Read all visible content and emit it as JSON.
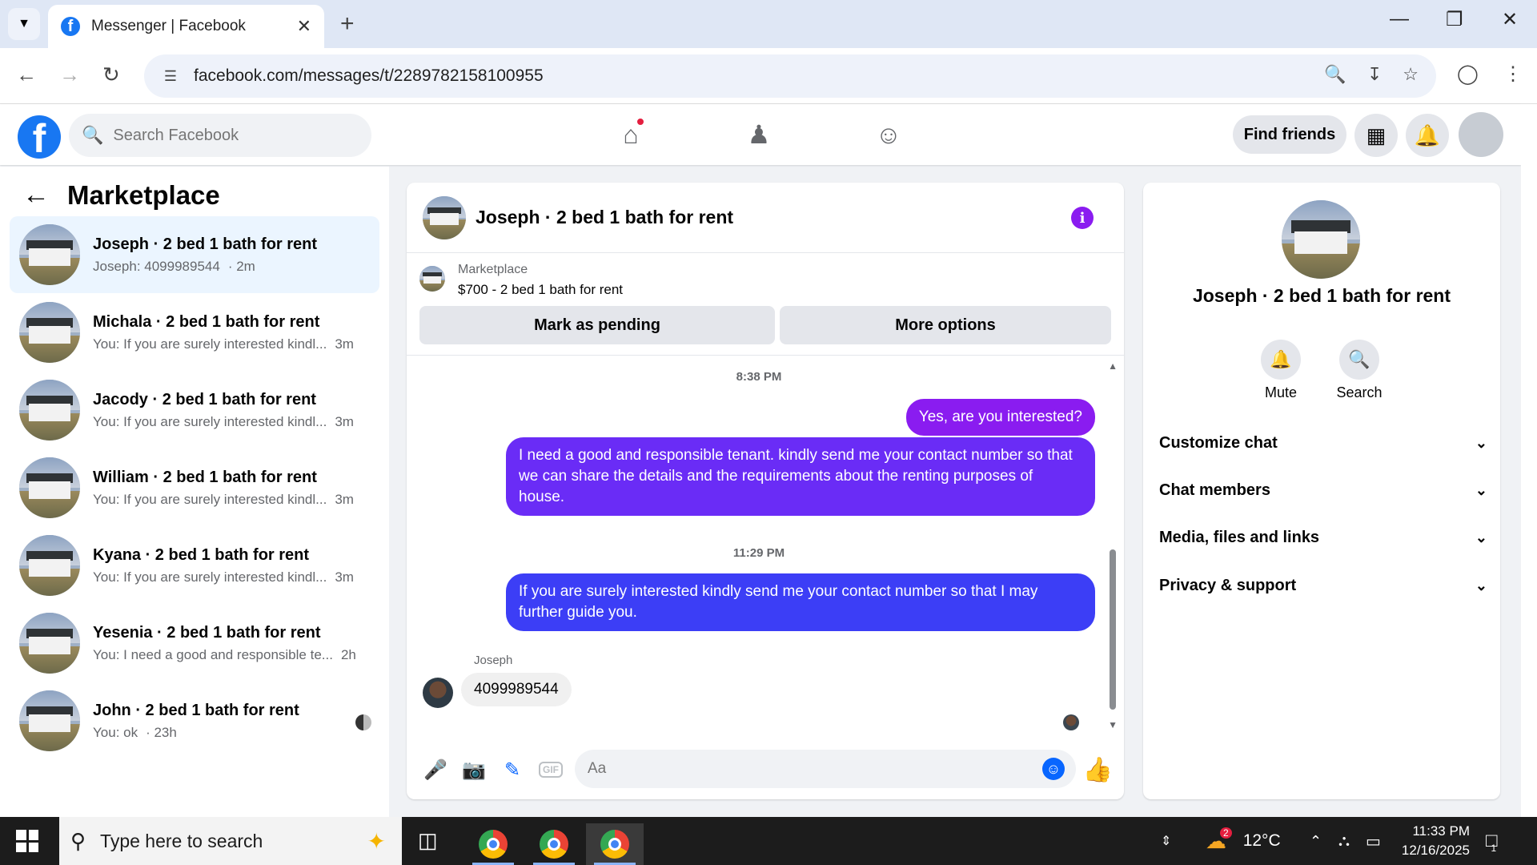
{
  "browser": {
    "tab_title": "Messenger | Facebook",
    "url": "facebook.com/messages/t/2289782158100955"
  },
  "fb": {
    "search_placeholder": "Search Facebook",
    "find_friends": "Find friends"
  },
  "left": {
    "title": "Marketplace",
    "conversations": [
      {
        "name": "Joseph · 2 bed 1 bath for rent",
        "preview": "Joseph: 4099989544",
        "time": "· 2m"
      },
      {
        "name": "Michala · 2 bed 1 bath for rent",
        "preview": "You: If you are surely interested kindl...",
        "time": "3m"
      },
      {
        "name": "Jacody · 2 bed 1 bath for rent",
        "preview": "You: If you are surely interested kindl...",
        "time": "3m"
      },
      {
        "name": "William · 2 bed 1 bath for rent",
        "preview": "You: If you are surely interested kindl...",
        "time": "3m"
      },
      {
        "name": "Kyana · 2 bed 1 bath for rent",
        "preview": "You: If you are surely interested kindl...",
        "time": "3m"
      },
      {
        "name": "Yesenia · 2 bed 1 bath for rent",
        "preview": "You: I need a good and responsible te...",
        "time": "2h"
      },
      {
        "name": "John · 2 bed 1 bath for rent",
        "preview": "You: ok",
        "time": "· 23h"
      }
    ]
  },
  "chat": {
    "title": "Joseph · 2 bed 1 bath for rent",
    "marketplace_label": "Marketplace",
    "listing": "$700 - 2 bed 1 bath for rent",
    "mark_pending": "Mark as pending",
    "more_options": "More options",
    "ts1": "8:38 PM",
    "msg1": "Yes, are you interested?",
    "msg2": "I need a good and responsible tenant.  kindly send me your contact number so that we can share the details and the requirements about the renting purposes of house.",
    "ts2": "11:29 PM",
    "msg3": "If you are surely interested kindly send me your contact number so that I may further guide you.",
    "sender": "Joseph",
    "reply": "4099989544",
    "composer_placeholder": "Aa",
    "gif": "GIF"
  },
  "details": {
    "title": "Joseph · 2 bed 1 bath for rent",
    "mute": "Mute",
    "search": "Search",
    "sections": [
      "Customize chat",
      "Chat members",
      "Media, files and links",
      "Privacy & support"
    ]
  },
  "taskbar": {
    "search_placeholder": "Type here to search",
    "weather_badge": "2",
    "temperature": "12°C",
    "time": "11:33 PM",
    "date": "12/16/2025",
    "notification_count": "1"
  },
  "colors": {
    "fb_blue": "#1877f2",
    "bubble_purple": "#8a1cf0",
    "bubble_violet": "#6a2cf6",
    "bubble_blue": "#3c3ef6"
  }
}
